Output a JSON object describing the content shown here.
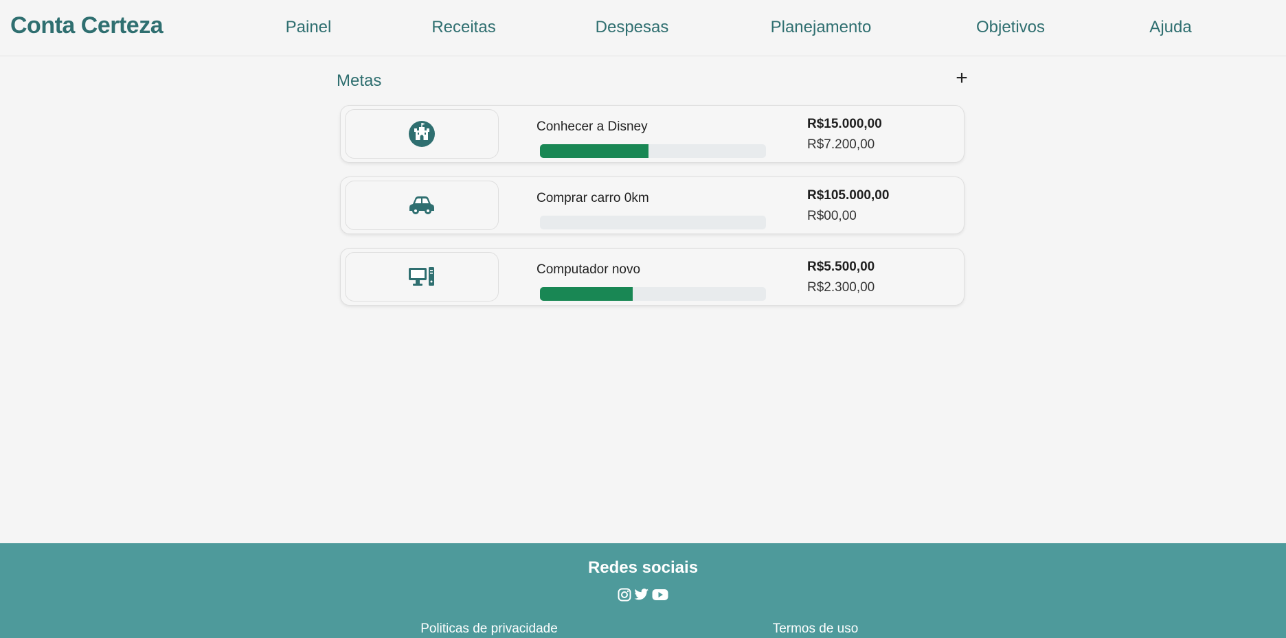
{
  "header": {
    "brand": "Conta Certeza",
    "nav": [
      "Painel",
      "Receitas",
      "Despesas",
      "Planejamento",
      "Objetivos",
      "Ajuda"
    ]
  },
  "main": {
    "section_title": "Metas",
    "add_label": "+",
    "goals": [
      {
        "icon": "castle-icon",
        "name": "Conhecer a Disney",
        "target": "R$15.000,00",
        "saved": "R$7.200,00",
        "progress": 0.48
      },
      {
        "icon": "car-icon",
        "name": "Comprar carro 0km",
        "target": "R$105.000,00",
        "saved": "R$00,00",
        "progress": 0
      },
      {
        "icon": "desktop-computer-icon",
        "name": "Computador novo",
        "target": "R$5.500,00",
        "saved": "R$2.300,00",
        "progress": 0.41
      }
    ]
  },
  "footer": {
    "title": "Redes sociais",
    "social_icons": [
      "instagram-icon",
      "twitter-icon",
      "youtube-icon"
    ],
    "links": [
      "Politicas de privacidade",
      "Termos de uso"
    ]
  },
  "colors": {
    "brand": "#2f6f70",
    "progress": "#198754",
    "footer": "#4e9a9b",
    "background": "#f5f5f5"
  }
}
